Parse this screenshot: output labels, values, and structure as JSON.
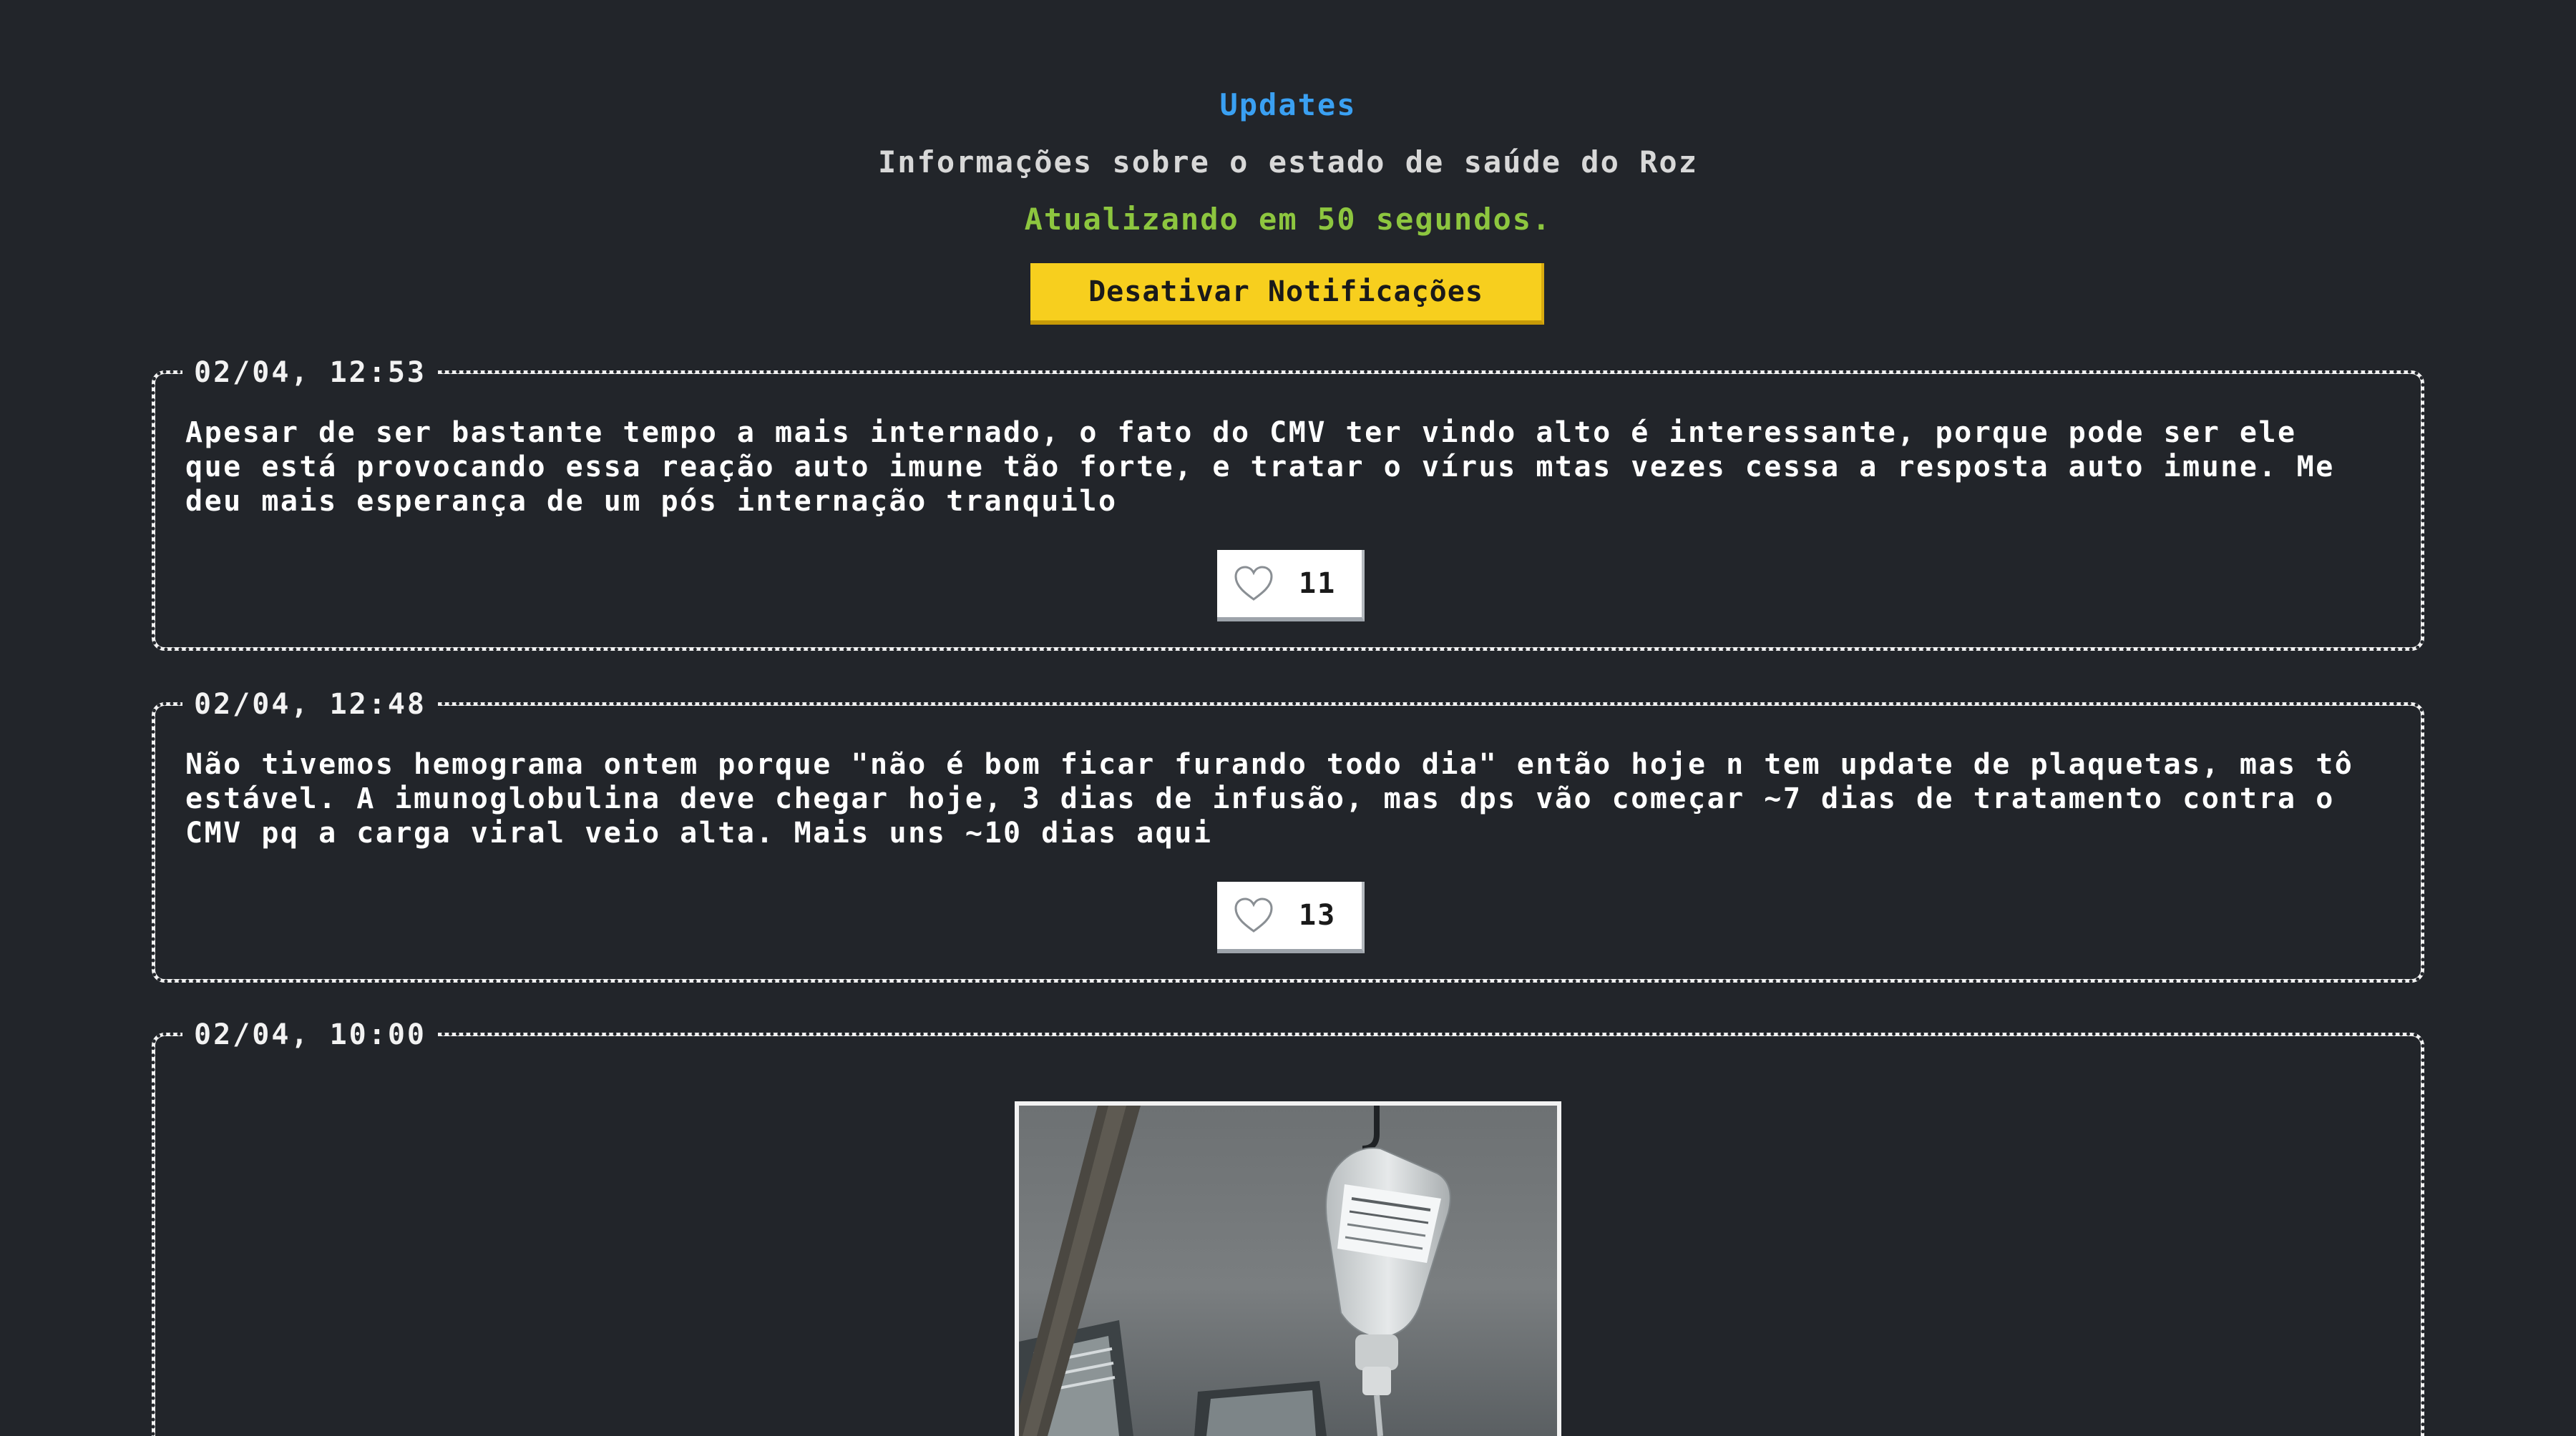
{
  "header": {
    "title": "Updates",
    "subtitle": "Informações sobre o estado de saúde do Roz",
    "status": "Atualizando em 50 segundos.",
    "notifications_button": "Desativar Notificações"
  },
  "posts": [
    {
      "date": "02/04, 12:53",
      "text": "Apesar de ser bastante tempo a mais internado, o fato do CMV ter vindo alto é interessante, porque pode ser ele que está provocando essa reação auto imune tão forte, e tratar o vírus mtas vezes cessa a resposta auto imune. Me deu mais esperança de um pós internação tranquilo",
      "likes": "11",
      "like_icon": "heart-outline-icon"
    },
    {
      "date": "02/04, 12:48",
      "text": "Não tivemos hemograma ontem porque \"não é bom ficar furando todo dia\" então hoje n tem update de plaquetas, mas tô estável. A imunoglobulina deve chegar hoje, 3 dias de infusão, mas dps vão começar ~7 dias de tratamento contra o CMV pq a carga viral veio alta. Mais uns ~10 dias aqui",
      "likes": "13",
      "like_icon": "heart-outline-icon"
    },
    {
      "date": "02/04, 10:00",
      "image": "photo of IV drip bag hanging in hospital room"
    }
  ],
  "colors": {
    "background": "#22252a",
    "title": "#3aa0f2",
    "status": "#8dc63f",
    "button": "#f7cf1e",
    "card_border": "#f2f2f2"
  }
}
